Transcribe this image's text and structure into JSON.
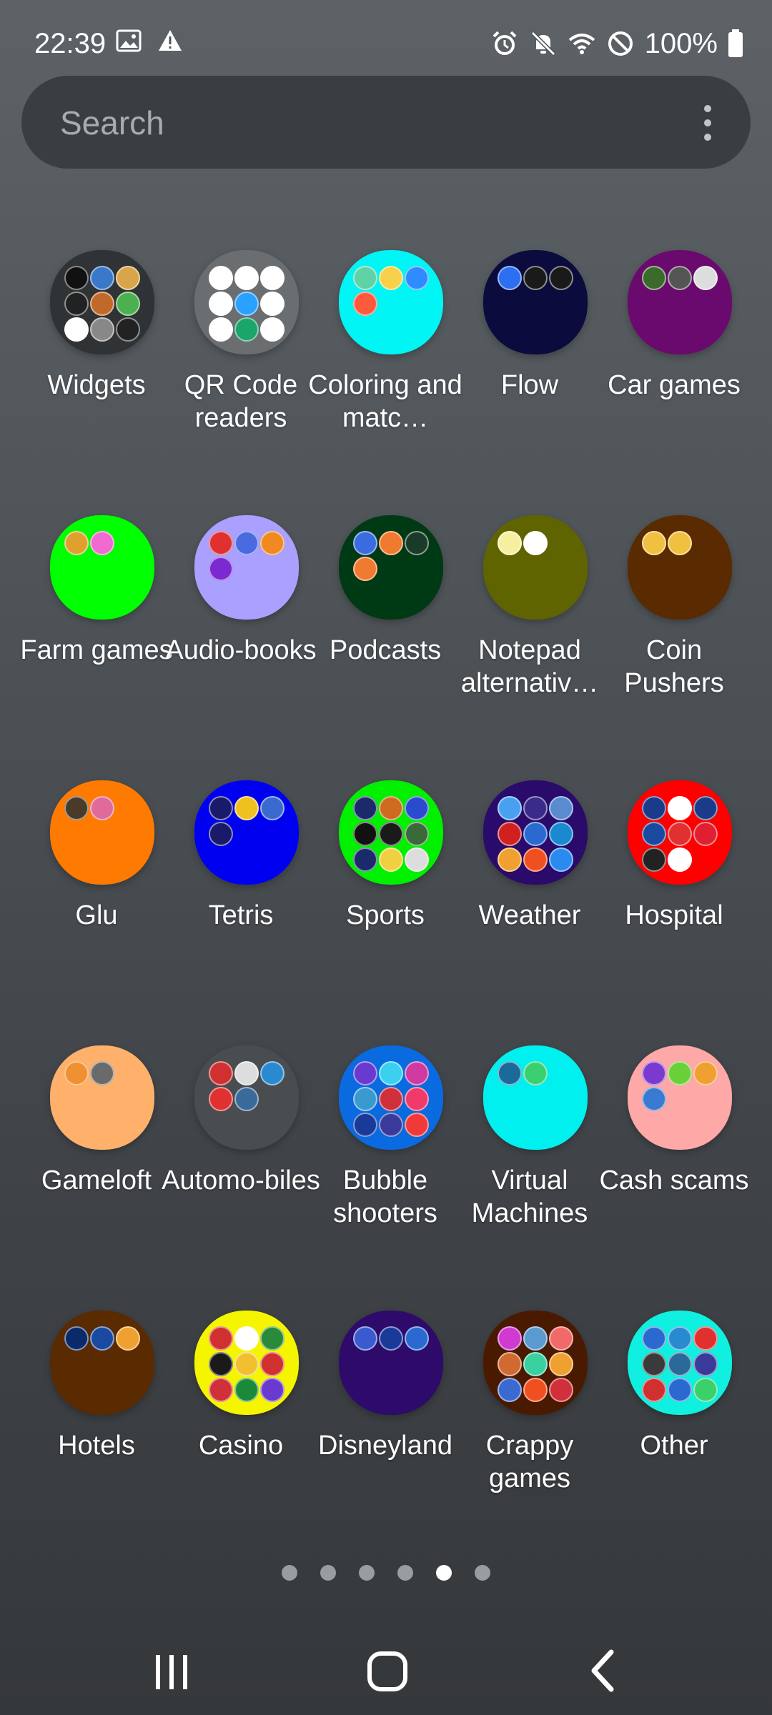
{
  "status_bar": {
    "time": "22:39",
    "left_icons": [
      "image-icon",
      "warning-icon"
    ],
    "right_icons": [
      "alarm-icon",
      "mute-icon",
      "wifi-icon",
      "do-not-disturb-icon",
      "battery-icon"
    ],
    "battery": "100%"
  },
  "search": {
    "placeholder": "Search"
  },
  "folders": [
    {
      "label": "Widgets",
      "color": "#2f3336",
      "minis": [
        "#111",
        "#3a78c9",
        "#d9a54b",
        "#222",
        "#c06a2a",
        "#4caf50",
        "#fff",
        "#888",
        "#222"
      ]
    },
    {
      "label": "QR Code readers",
      "color": "#6b6e71",
      "minis": [
        "#fff",
        "#fff",
        "#fff",
        "#fff",
        "#2aa0ff",
        "#fff",
        "#fff",
        "#1aa56b",
        "#fff"
      ]
    },
    {
      "label": "Coloring and matc…",
      "color": "#00f5f5",
      "minis": [
        "#5fd3a5",
        "#f7d14a",
        "#2f8cff",
        "#ff5a3c"
      ]
    },
    {
      "label": "Flow",
      "color": "#0b0b3d",
      "minis": [
        "#2c6ff0",
        "#1a1a1a",
        "#1a1a1a"
      ]
    },
    {
      "label": "Car games",
      "color": "#6a0a6e",
      "minis": [
        "#3a6b2a",
        "#555",
        "#ddd"
      ]
    },
    {
      "label": "Farm games",
      "color": "#00ff00",
      "minis": [
        "#e0a030",
        "#f06ad0"
      ]
    },
    {
      "label": "Audio-books",
      "color": "#a9a0ff",
      "minis": [
        "#e03030",
        "#4a6be0",
        "#f08a20",
        "#7a2ad0"
      ]
    },
    {
      "label": "Podcasts",
      "color": "#003a14",
      "minis": [
        "#3a6be0",
        "#f07a30",
        "#1a3a2a",
        "#f07a30"
      ]
    },
    {
      "label": "Notepad alternativ…",
      "color": "#5f6300",
      "minis": [
        "#f5f0a0",
        "#ffffff"
      ]
    },
    {
      "label": "Coin Pushers",
      "color": "#5a2a00",
      "minis": [
        "#f0c040",
        "#f0c040"
      ]
    },
    {
      "label": "Glu",
      "color": "#ff7a00",
      "minis": [
        "#4a3a2a",
        "#e06a9a"
      ]
    },
    {
      "label": "Tetris",
      "color": "#0000f0",
      "minis": [
        "#1a1a6a",
        "#f0c020",
        "#3a6ad0",
        "#1a1a6a"
      ]
    },
    {
      "label": "Sports",
      "color": "#00f000",
      "minis": [
        "#1a2a6a",
        "#d06a20",
        "#2a4ad0",
        "#111",
        "#1a1a1a",
        "#3a6a3a",
        "#1a2a6a",
        "#f0d040",
        "#ddd"
      ]
    },
    {
      "label": "Weather",
      "color": "#2a0a6a",
      "minis": [
        "#4aa0f0",
        "#3a2a8a",
        "#5a8ad0",
        "#d02020",
        "#2a6ad0",
        "#1a8ad0",
        "#f0a030",
        "#f05020",
        "#2a8af0"
      ]
    },
    {
      "label": "Hospital",
      "color": "#ff0000",
      "minis": [
        "#1a3a8a",
        "#fff",
        "#1a3a8a",
        "#1a4aa0",
        "#e03030",
        "#e02030",
        "#222",
        "#fff"
      ]
    },
    {
      "label": "Gameloft",
      "color": "#ffb06a",
      "minis": [
        "#f09030",
        "#6a6a6a"
      ]
    },
    {
      "label": "Automo-biles",
      "color": "#4a4d50",
      "minis": [
        "#d03030",
        "#ddd",
        "#2a8ad0",
        "#e03030",
        "#3a6a9a"
      ]
    },
    {
      "label": "Bubble shooters",
      "color": "#0a6ae0",
      "minis": [
        "#6a3ad0",
        "#3ad0f0",
        "#d03aa0",
        "#3a9ad0",
        "#d0303a",
        "#f03a6a",
        "#1a3a9a",
        "#3a3a9a",
        "#f03a3a"
      ]
    },
    {
      "label": "Virtual Machines",
      "color": "#00f0f0",
      "minis": [
        "#1a6a9a",
        "#3ad070"
      ]
    },
    {
      "label": "Cash scams",
      "color": "#ffa8a8",
      "minis": [
        "#7a3ad0",
        "#6ad03a",
        "#f0a030",
        "#3a7ad0"
      ]
    },
    {
      "label": "Hotels",
      "color": "#5a2a00",
      "minis": [
        "#0a2a6a",
        "#1a4aa0",
        "#f0a030"
      ]
    },
    {
      "label": "Casino",
      "color": "#f5f500",
      "minis": [
        "#d03030",
        "#fff",
        "#2a8a3a",
        "#1a1a1a",
        "#f0c030",
        "#d03030",
        "#d0303a",
        "#1a8a3a",
        "#6a3ad0"
      ]
    },
    {
      "label": "Disneyland",
      "color": "#2e0a6a",
      "minis": [
        "#3a5ad0",
        "#1a3a9a",
        "#2a6ad0"
      ]
    },
    {
      "label": "Crappy games",
      "color": "#4a1a00",
      "minis": [
        "#d03ad0",
        "#5a9ad0",
        "#f06a6a",
        "#d06a30",
        "#3ad0a0",
        "#f0a030",
        "#3a6ad0",
        "#f05020",
        "#d0303a"
      ]
    },
    {
      "label": "Other",
      "color": "#10f0e0",
      "minis": [
        "#2a6ad0",
        "#2a8ad0",
        "#e03030",
        "#3a3a3a",
        "#2a6a9a",
        "#3a3a9a",
        "#d03030",
        "#2a6ad0",
        "#3ad06a"
      ]
    }
  ],
  "page_indicator": {
    "total": 6,
    "active": 5
  },
  "nav_bar": {
    "buttons": [
      "recent-apps",
      "home",
      "back"
    ]
  }
}
